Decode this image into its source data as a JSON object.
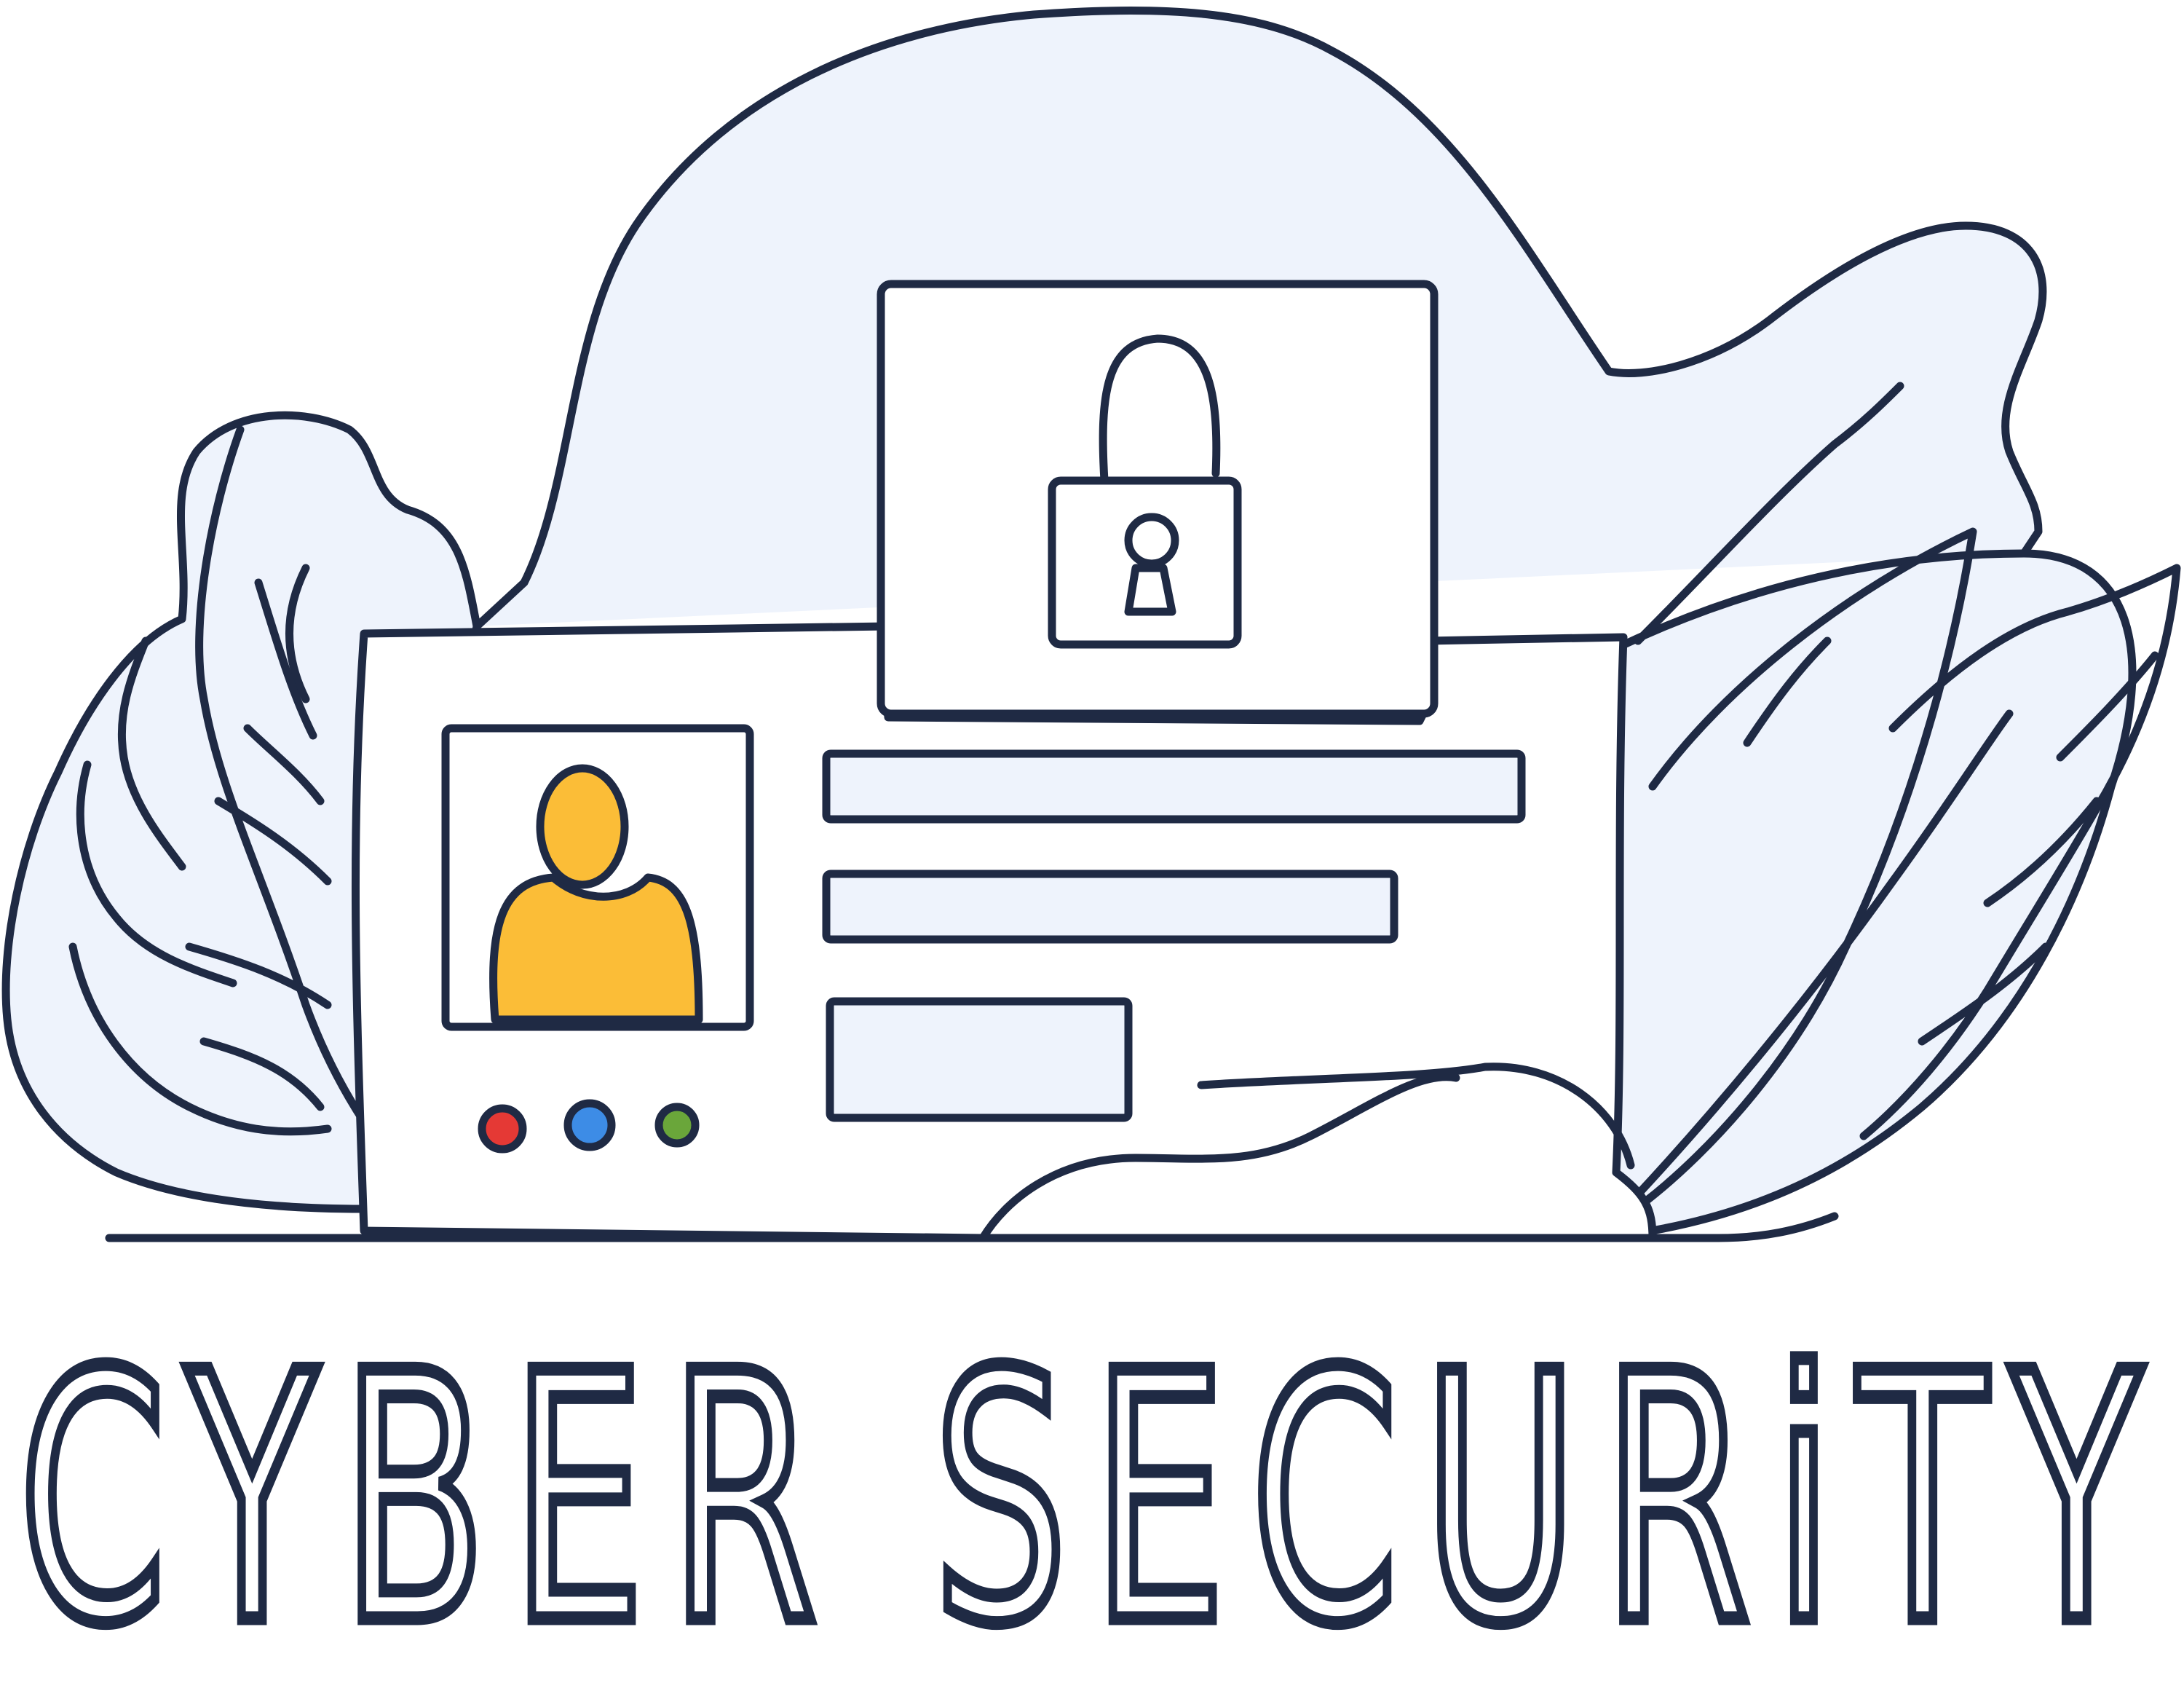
{
  "caption": "CYBER SECURiTY",
  "illustration": {
    "icons": [
      "padlock-icon",
      "user-avatar-icon",
      "status-dot-red-icon",
      "status-dot-blue-icon",
      "status-dot-green-icon"
    ],
    "form_fields": [
      "text-field",
      "text-field",
      "button-field"
    ]
  },
  "colors": {
    "outline": "#1f2a44",
    "background_blob": "#eef3fc",
    "avatar_fill": "#fbbd37",
    "dot_red": "#e53935",
    "dot_blue": "#3d8ce6",
    "dot_green": "#6aa63a",
    "panel_fill": "#ffffff"
  }
}
